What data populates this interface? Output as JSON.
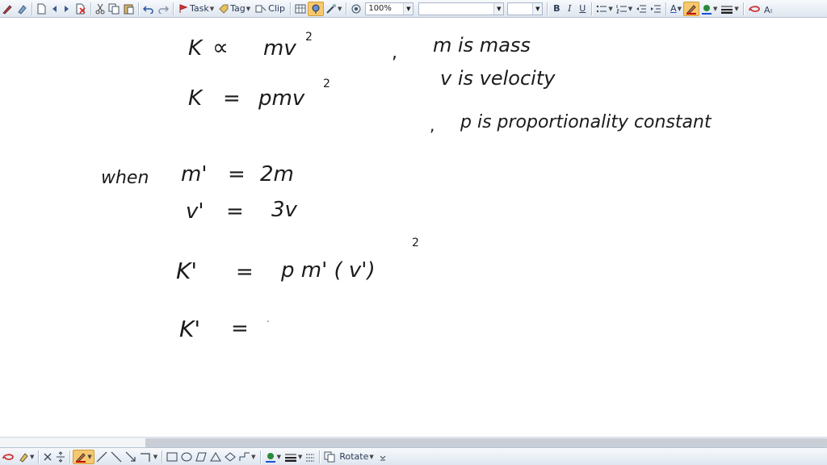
{
  "toolbar": {
    "zoom_value": "100%",
    "task_label": "Task",
    "tag_label": "Tag",
    "clip_label": "Clip",
    "bold_label": "B",
    "italic_label": "I",
    "underline_label": "U",
    "font_size_label": "A",
    "accent_color": "#f6c870"
  },
  "bottom_toolbar": {
    "rotate_label": "Rotate"
  },
  "note": {
    "line1_k": "K",
    "line1_prop": "∝",
    "line1_rhs": "mv",
    "line1_exp": "2",
    "line1_comma": ",",
    "line1_note": "m is mass",
    "line2_k": "K",
    "line2_eq": "=",
    "line2_rhs": "pmv",
    "line2_exp": "2",
    "line2_note": "v is velocity",
    "line3_comma": ",",
    "line3_note": "p is proportionality constant",
    "when_label": "when",
    "m_prime": "m'",
    "eq1": "=",
    "two_m": "2m",
    "v_prime": "v'",
    "eq2": "=",
    "three_v": "3v",
    "k_prime_1": "K'",
    "eq3": "=",
    "rhs3": "p m' ( v')",
    "rhs3_exp": "2",
    "k_prime_2": "K'",
    "eq4": "="
  }
}
